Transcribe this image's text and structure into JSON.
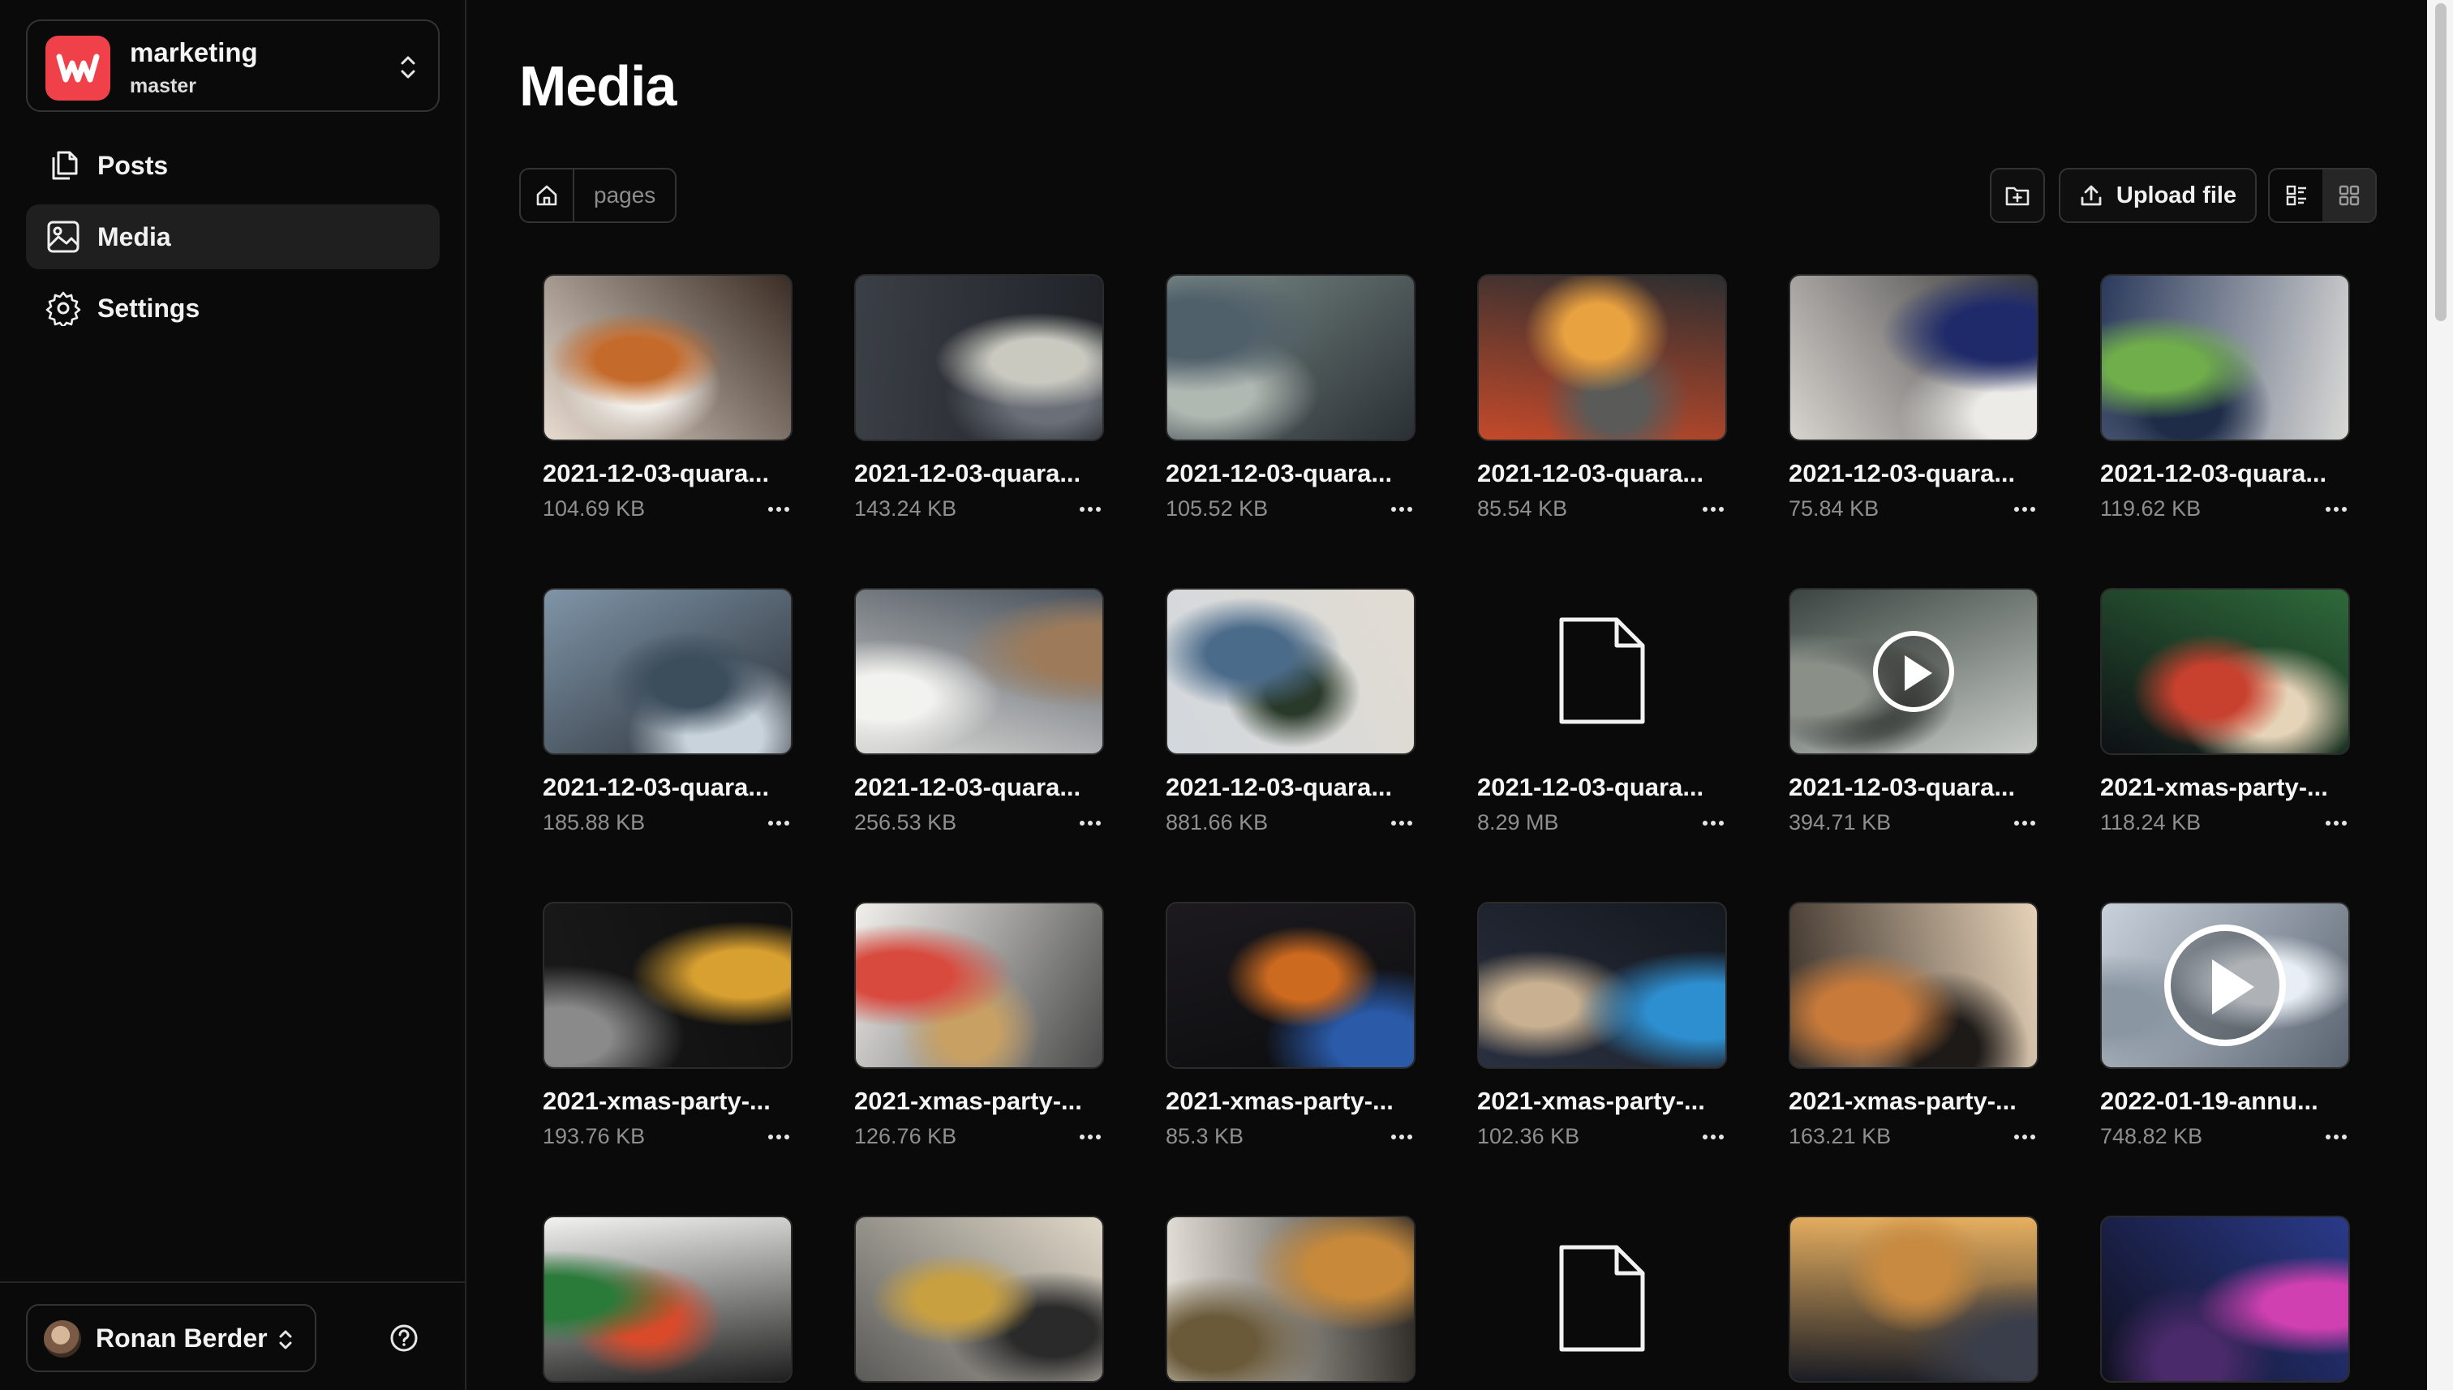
{
  "repo": {
    "name": "marketing",
    "branch": "master"
  },
  "nav": [
    {
      "label": "Posts",
      "icon": "posts-icon",
      "active": false
    },
    {
      "label": "Media",
      "icon": "image-icon",
      "active": true
    },
    {
      "label": "Settings",
      "icon": "gear-icon",
      "active": false
    }
  ],
  "user": {
    "name": "Ronan Berder"
  },
  "page": {
    "title": "Media"
  },
  "breadcrumb": {
    "path": "pages"
  },
  "toolbar": {
    "upload_label": "Upload file"
  },
  "colors": {
    "brand": "#f0414a",
    "background": "#0a0a0a"
  },
  "files": [
    {
      "name": "2021-12-03-quara...",
      "size": "104.69 KB",
      "kind": "image"
    },
    {
      "name": "2021-12-03-quara...",
      "size": "143.24 KB",
      "kind": "image"
    },
    {
      "name": "2021-12-03-quara...",
      "size": "105.52 KB",
      "kind": "image"
    },
    {
      "name": "2021-12-03-quara...",
      "size": "85.54 KB",
      "kind": "image"
    },
    {
      "name": "2021-12-03-quara...",
      "size": "75.84 KB",
      "kind": "image"
    },
    {
      "name": "2021-12-03-quara...",
      "size": "119.62 KB",
      "kind": "image"
    },
    {
      "name": "2021-12-03-quara...",
      "size": "185.88 KB",
      "kind": "image"
    },
    {
      "name": "2021-12-03-quara...",
      "size": "256.53 KB",
      "kind": "image"
    },
    {
      "name": "2021-12-03-quara...",
      "size": "881.66 KB",
      "kind": "image"
    },
    {
      "name": "2021-12-03-quara...",
      "size": "8.29 MB",
      "kind": "file"
    },
    {
      "name": "2021-12-03-quara...",
      "size": "394.71 KB",
      "kind": "video"
    },
    {
      "name": "2021-xmas-party-...",
      "size": "118.24 KB",
      "kind": "image"
    },
    {
      "name": "2021-xmas-party-...",
      "size": "193.76 KB",
      "kind": "image"
    },
    {
      "name": "2021-xmas-party-...",
      "size": "126.76 KB",
      "kind": "image"
    },
    {
      "name": "2021-xmas-party-...",
      "size": "85.3 KB",
      "kind": "image"
    },
    {
      "name": "2021-xmas-party-...",
      "size": "102.36 KB",
      "kind": "image"
    },
    {
      "name": "2021-xmas-party-...",
      "size": "163.21 KB",
      "kind": "image"
    },
    {
      "name": "2022-01-19-annu...",
      "size": "748.82 KB",
      "kind": "video"
    },
    {
      "name": "",
      "size": "",
      "kind": "image"
    },
    {
      "name": "",
      "size": "",
      "kind": "image"
    },
    {
      "name": "",
      "size": "",
      "kind": "image"
    },
    {
      "name": "",
      "size": "",
      "kind": "file"
    },
    {
      "name": "",
      "size": "",
      "kind": "image"
    },
    {
      "name": "",
      "size": "",
      "kind": "image"
    }
  ]
}
